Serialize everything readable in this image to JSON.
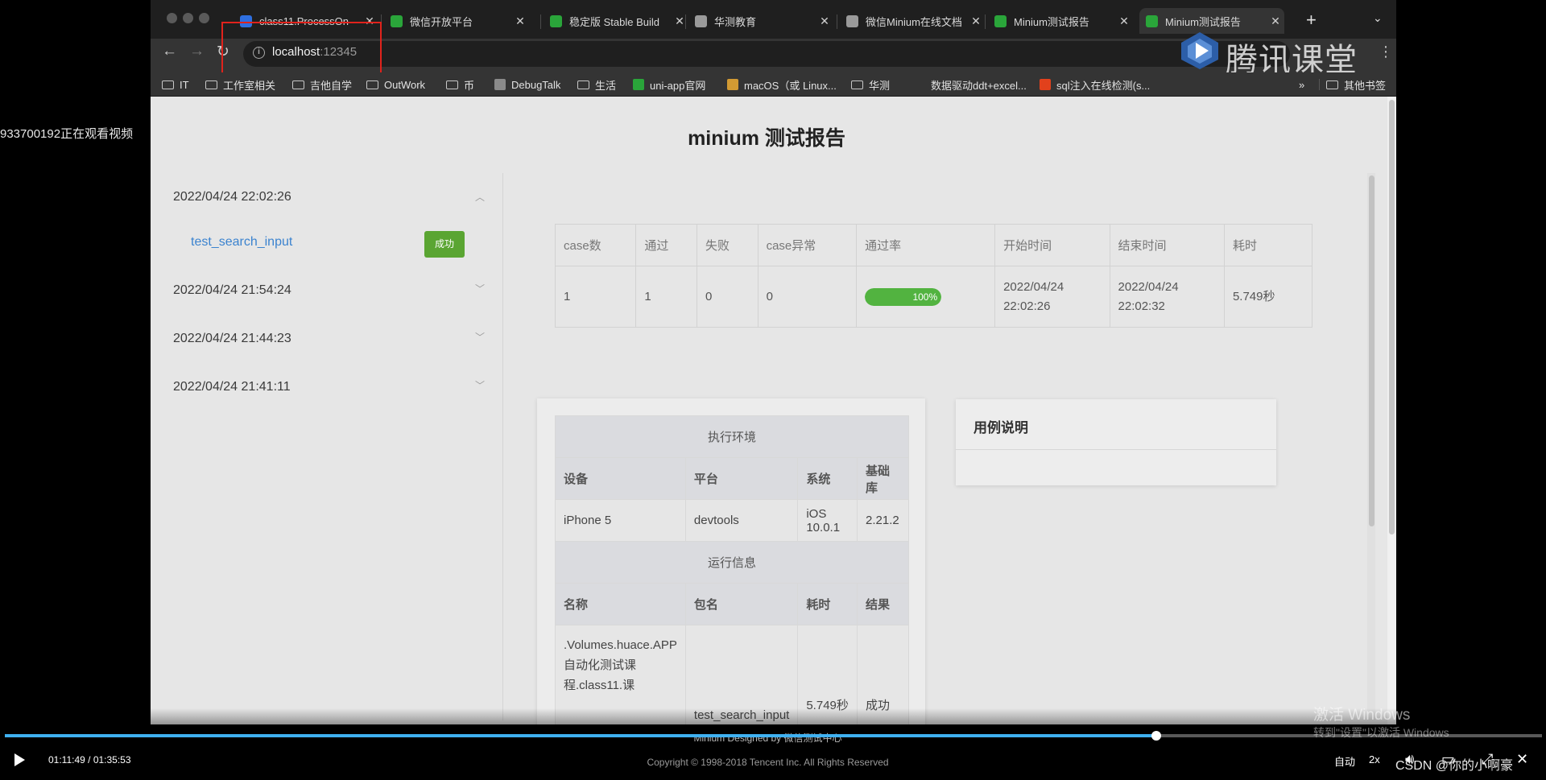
{
  "watch_notice": "933700192正在观看视频",
  "browser": {
    "tabs": [
      {
        "title": "class11.ProcessOn",
        "favicon_color": "#2e6fe0"
      },
      {
        "title": "微信开放平台",
        "favicon_color": "#2aa53a"
      },
      {
        "title": "稳定版 Stable Build",
        "favicon_color": "#2aa53a"
      },
      {
        "title": "华测教育",
        "favicon_color": "#9a9a9a"
      },
      {
        "title": "微信Minium在线文档",
        "favicon_color": "#9a9a9a"
      },
      {
        "title": "Minium测试报告",
        "favicon_color": "#2aa53a"
      },
      {
        "title": "Minium测试报告",
        "favicon_color": "#2aa53a",
        "active": true
      }
    ],
    "close_glyph": "✕",
    "new_tab": "+",
    "tab_menu": "⌄",
    "url_host": "localhost",
    "url_port": ":12345",
    "logo_text": "腾讯课堂",
    "bookmarks": [
      {
        "label": "IT",
        "type": "folder"
      },
      {
        "label": "工作室相关",
        "type": "folder"
      },
      {
        "label": "吉他自学",
        "type": "folder"
      },
      {
        "label": "OutWork",
        "type": "folder"
      },
      {
        "label": "币",
        "type": "folder"
      },
      {
        "label": "DebugTalk",
        "type": "fav",
        "color": "#8a8a8a"
      },
      {
        "label": "生活",
        "type": "folder"
      },
      {
        "label": "uni-app官网",
        "type": "fav",
        "color": "#2aa53a"
      },
      {
        "label": "macOS（或 Linux...",
        "type": "fav",
        "color": "#d29a33"
      },
      {
        "label": "华测",
        "type": "folder"
      },
      {
        "label": "数据驱动ddt+excel...",
        "type": "none"
      },
      {
        "label": "sql注入在线检测(s...",
        "type": "fav",
        "color": "#e2411c"
      }
    ],
    "bookmarks_more": "»",
    "other_bookmarks": "其他书签"
  },
  "report": {
    "title": "minium 测试报告",
    "sidebar": [
      {
        "date": "2022/04/24 22:02:26",
        "expanded": true
      },
      {
        "date": "2022/04/24 21:54:24",
        "expanded": false
      },
      {
        "date": "2022/04/24 21:44:23",
        "expanded": false
      },
      {
        "date": "2022/04/24 21:41:11",
        "expanded": false
      }
    ],
    "case_name": "test_search_input",
    "case_status": "成功",
    "summary_headers": [
      "case数",
      "通过",
      "失败",
      "case异常",
      "通过率",
      "开始时间",
      "结束时间",
      "耗时"
    ],
    "summary_row": {
      "cases": "1",
      "passed": "1",
      "failed": "0",
      "errors": "0",
      "pass_rate": 100,
      "pass_rate_label": "100%",
      "start_date": "2022/04/24",
      "start_time": "22:02:26",
      "end_date": "2022/04/24",
      "end_time": "22:02:32",
      "duration": "5.749秒"
    },
    "env_title": "执行环境",
    "env_headers": [
      "设备",
      "平台",
      "系统",
      "基础库"
    ],
    "env_values": [
      "iPhone 5",
      "devtools",
      "iOS 10.0.1",
      "2.21.2"
    ],
    "run_title": "运行信息",
    "run_headers": [
      "名称",
      "包名",
      "耗时",
      "结果"
    ],
    "run_values": [
      ".Volumes.huace.APP自动化测试课程.class11.课",
      "test_search_input",
      "5.749秒",
      "成功"
    ],
    "desc_title": "用例说明",
    "footer_line1": "Minium Designed by 微信测试中心",
    "footer_line2": "Copyright © 1998-2018 Tencent Inc. All Rights Reserved"
  },
  "video": {
    "time": "01:11:49 / 01:35:53",
    "progress": 0.7489,
    "quality": "自动",
    "speed": "2x",
    "activate_line1": "激活 Windows",
    "activate_line2": "转到\"设置\"以激活 Windows",
    "watermark": "CSDN @你的小啊豪"
  }
}
